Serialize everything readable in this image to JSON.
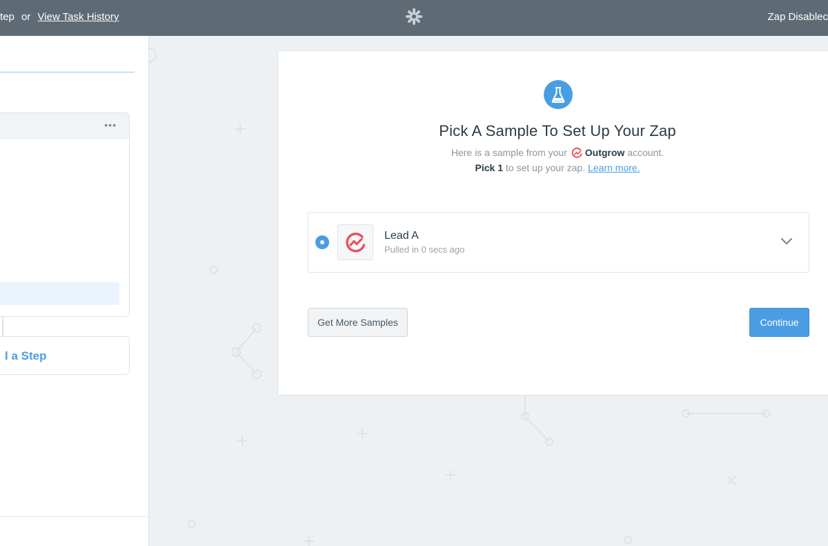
{
  "topbar": {
    "left_step_text": "tep",
    "or_text": "or",
    "task_history_link": "View Task History",
    "status": "Zap Disablec"
  },
  "sidebar": {
    "add_step_label": "l a Step"
  },
  "main": {
    "heading": "Pick A Sample To Set Up Your Zap",
    "subtitle_prefix": "Here is a sample from your",
    "app_name": "Outgrow",
    "subtitle_suffix": "account.",
    "pick_strong": "Pick 1",
    "pick_rest": "to set up your zap.",
    "learn_more": "Learn more.",
    "sample": {
      "name": "Lead A",
      "meta": "Pulled in 0 secs ago"
    },
    "buttons": {
      "more_samples": "Get More Samples",
      "continue": "Continue"
    }
  },
  "colors": {
    "accent": "#4a9de2",
    "topbar": "#5f6b74",
    "outgrow_brand": "#e8535e"
  },
  "icons": [
    "zapier-logo-icon",
    "flask-icon",
    "outgrow-logo-icon",
    "chevron-down-icon",
    "more-dots-icon",
    "radio-selected-icon"
  ]
}
